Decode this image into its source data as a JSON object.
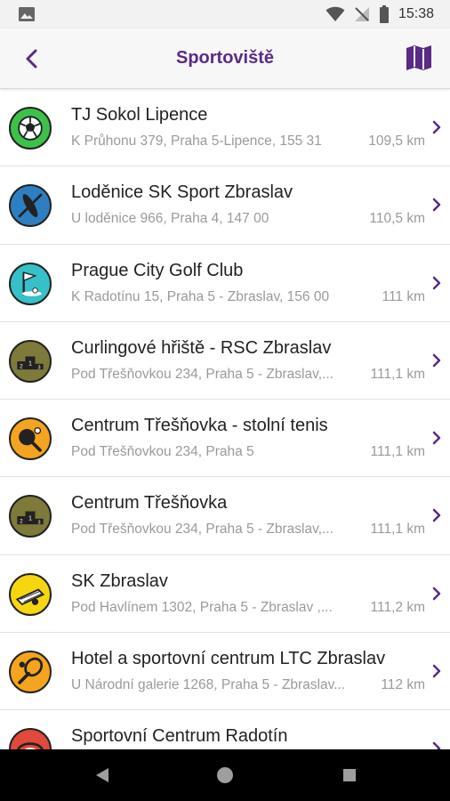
{
  "status": {
    "time": "15:38"
  },
  "header": {
    "title": "Sportoviště"
  },
  "colors": {
    "accent": "#5a2a86"
  },
  "venues": [
    {
      "name": "TJ Sokol Lipence",
      "address": "K Průhonu 379, Praha 5-Lipence, 155 31",
      "distance": "109,5 km",
      "icon": "soccer-ball-icon",
      "color": "#3cc24a"
    },
    {
      "name": "Loděnice SK Sport Zbraslav",
      "address": "U loděnice 966, Praha 4, 147 00",
      "distance": "110,5 km",
      "icon": "kayak-icon",
      "color": "#2d7fc1"
    },
    {
      "name": "Prague City Golf Club",
      "address": "K Radotínu 15, Praha 5 - Zbraslav, 156 00",
      "distance": "111 km",
      "icon": "golf-flag-icon",
      "color": "#36c0c8"
    },
    {
      "name": "Curlingové hřiště - RSC Zbraslav",
      "address": "Pod Třešňovkou 234, Praha 5 - Zbraslav,...",
      "distance": "111,1 km",
      "icon": "podium-icon",
      "color": "#7d7a3a"
    },
    {
      "name": "Centrum Třešňovka - stolní tenis",
      "address": "Pod Třešňovkou 234, Praha 5",
      "distance": "111,1 km",
      "icon": "table-tennis-icon",
      "color": "#f4a41e"
    },
    {
      "name": "Centrum Třešňovka",
      "address": "Pod Třešňovkou 234, Praha 5 - Zbraslav,...",
      "distance": "111,1 km",
      "icon": "podium-icon",
      "color": "#7d7a3a"
    },
    {
      "name": "SK Zbraslav",
      "address": "Pod Havlínem 1302, Praha 5 - Zbraslav ,...",
      "distance": "111,2 km",
      "icon": "soccer-goal-icon",
      "color": "#f6d60e"
    },
    {
      "name": "Hotel a sportovní centrum LTC Zbraslav",
      "address": "U Národní galerie 1268, Praha 5 - Zbraslav...",
      "distance": "112 km",
      "icon": "tennis-racket-icon",
      "color": "#f4a41e"
    },
    {
      "name": "Sportovní Centrum Radotín",
      "address": "",
      "distance": "",
      "icon": "stadium-icon",
      "color": "#e0493b"
    }
  ]
}
